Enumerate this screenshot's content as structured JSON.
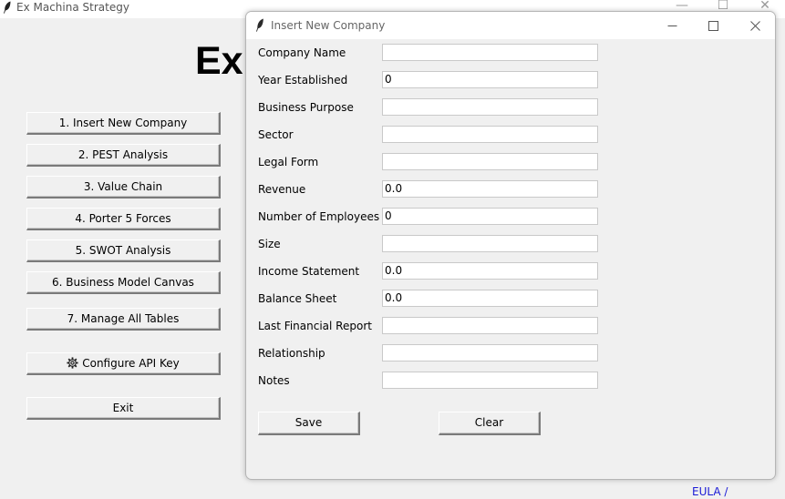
{
  "main_window": {
    "title": "Ex Machina Strategy",
    "heading": "Ex",
    "controls": {
      "minimize": "—",
      "maximize": "☐",
      "close": "✕"
    },
    "menu": [
      {
        "label": "1. Insert New Company"
      },
      {
        "label": "2. PEST Analysis"
      },
      {
        "label": "3. Value Chain"
      },
      {
        "label": "4. Porter 5 Forces"
      },
      {
        "label": "5. SWOT Analysis"
      },
      {
        "label": "6. Business Model Canvas"
      },
      {
        "label": "7. Manage All Tables"
      },
      {
        "label": "Configure API Key",
        "icon": "gear-icon"
      },
      {
        "label": "Exit"
      }
    ],
    "eula_link": "EULA / Disclaimer"
  },
  "dialog": {
    "title": "Insert New Company",
    "fields": [
      {
        "label": "Company Name",
        "value": ""
      },
      {
        "label": "Year Established",
        "value": "0"
      },
      {
        "label": "Business Purpose",
        "value": ""
      },
      {
        "label": "Sector",
        "value": ""
      },
      {
        "label": "Legal Form",
        "value": ""
      },
      {
        "label": "Revenue",
        "value": "0.0"
      },
      {
        "label": "Number of Employees",
        "value": "0"
      },
      {
        "label": "Size",
        "value": ""
      },
      {
        "label": "Income Statement",
        "value": "0.0"
      },
      {
        "label": "Balance Sheet",
        "value": "0.0"
      },
      {
        "label": "Last Financial Report",
        "value": ""
      },
      {
        "label": "Relationship",
        "value": ""
      },
      {
        "label": "Notes",
        "value": ""
      }
    ],
    "save_label": "Save",
    "clear_label": "Clear"
  },
  "colors": {
    "background": "#f0f0f0",
    "link": "#1a1ad6",
    "titlebar": "#ffffff"
  }
}
